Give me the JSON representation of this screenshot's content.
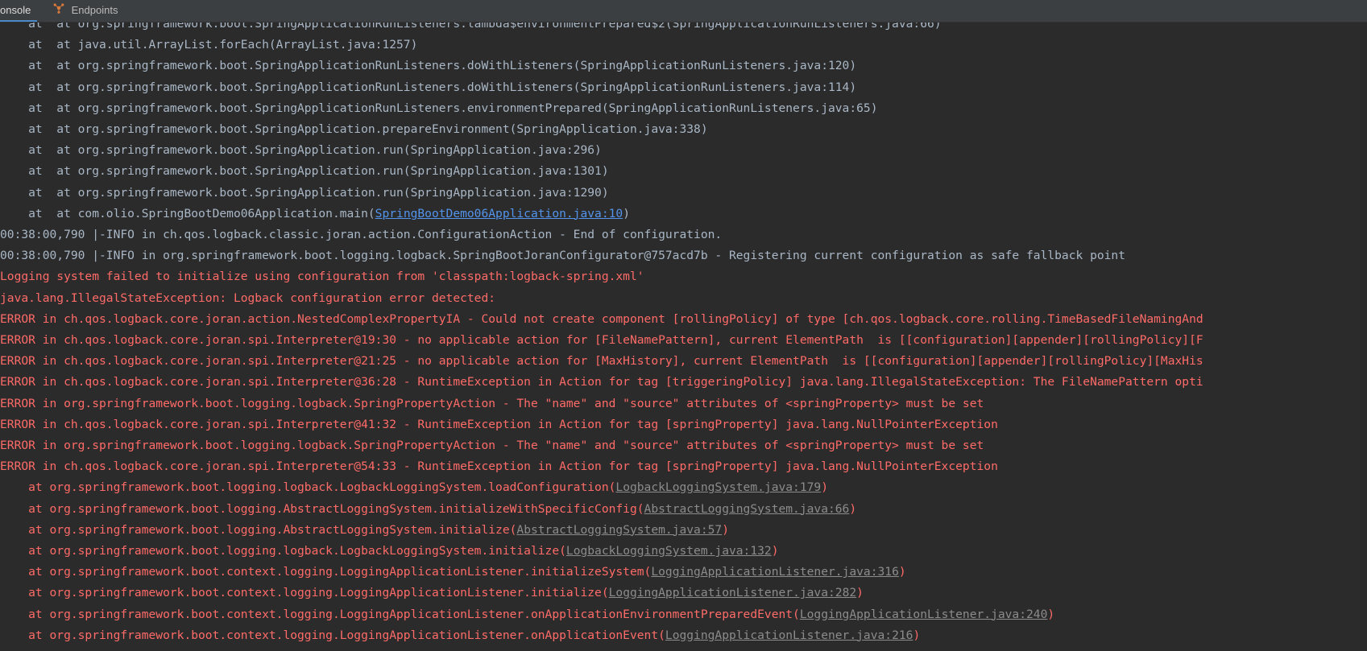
{
  "tabs": [
    {
      "label": "onsole"
    },
    {
      "label": "Endpoints"
    }
  ],
  "lines": [
    {
      "kind": "normal",
      "text": "    at  at org.springframework.boot.SpringApplicationRunListeners.lambda$environmentPrepared$2(SpringApplicationRunListeners.java:66)"
    },
    {
      "kind": "normal",
      "text": "    at  at java.util.ArrayList.forEach(ArrayList.java:1257)"
    },
    {
      "kind": "normal",
      "text": "    at  at org.springframework.boot.SpringApplicationRunListeners.doWithListeners(SpringApplicationRunListeners.java:120)"
    },
    {
      "kind": "normal",
      "text": "    at  at org.springframework.boot.SpringApplicationRunListeners.doWithListeners(SpringApplicationRunListeners.java:114)"
    },
    {
      "kind": "normal",
      "text": "    at  at org.springframework.boot.SpringApplicationRunListeners.environmentPrepared(SpringApplicationRunListeners.java:65)"
    },
    {
      "kind": "normal",
      "text": "    at  at org.springframework.boot.SpringApplication.prepareEnvironment(SpringApplication.java:338)"
    },
    {
      "kind": "normal",
      "text": "    at  at org.springframework.boot.SpringApplication.run(SpringApplication.java:296)"
    },
    {
      "kind": "normal",
      "text": "    at  at org.springframework.boot.SpringApplication.run(SpringApplication.java:1301)"
    },
    {
      "kind": "normal",
      "text": "    at  at org.springframework.boot.SpringApplication.run(SpringApplication.java:1290)"
    },
    {
      "kind": "normal",
      "text": "    at  at com.olio.SpringBootDemo06Application.main(",
      "link": "SpringBootDemo06Application.java:10",
      "link_style": "blue",
      "suffix": ")"
    },
    {
      "kind": "normal",
      "text": "00:38:00,790 |-INFO in ch.qos.logback.classic.joran.action.ConfigurationAction - End of configuration."
    },
    {
      "kind": "normal",
      "text": "00:38:00,790 |-INFO in org.springframework.boot.logging.logback.SpringBootJoranConfigurator@757acd7b - Registering current configuration as safe fallback point"
    },
    {
      "kind": "error",
      "text": "Logging system failed to initialize using configuration from 'classpath:logback-spring.xml'"
    },
    {
      "kind": "error",
      "text": "java.lang.IllegalStateException: Logback configuration error detected:"
    },
    {
      "kind": "error",
      "text": "ERROR in ch.qos.logback.core.joran.action.NestedComplexPropertyIA - Could not create component [rollingPolicy] of type [ch.qos.logback.core.rolling.TimeBasedFileNamingAnd"
    },
    {
      "kind": "error",
      "text": "ERROR in ch.qos.logback.core.joran.spi.Interpreter@19:30 - no applicable action for [FileNamePattern], current ElementPath  is [[configuration][appender][rollingPolicy][F"
    },
    {
      "kind": "error",
      "text": "ERROR in ch.qos.logback.core.joran.spi.Interpreter@21:25 - no applicable action for [MaxHistory], current ElementPath  is [[configuration][appender][rollingPolicy][MaxHis"
    },
    {
      "kind": "error",
      "text": "ERROR in ch.qos.logback.core.joran.spi.Interpreter@36:28 - RuntimeException in Action for tag [triggeringPolicy] java.lang.IllegalStateException: The FileNamePattern opti"
    },
    {
      "kind": "error",
      "text": "ERROR in org.springframework.boot.logging.logback.SpringPropertyAction - The \"name\" and \"source\" attributes of <springProperty> must be set"
    },
    {
      "kind": "error",
      "text": "ERROR in ch.qos.logback.core.joran.spi.Interpreter@41:32 - RuntimeException in Action for tag [springProperty] java.lang.NullPointerException"
    },
    {
      "kind": "error",
      "text": "ERROR in org.springframework.boot.logging.logback.SpringPropertyAction - The \"name\" and \"source\" attributes of <springProperty> must be set"
    },
    {
      "kind": "error",
      "text": "ERROR in ch.qos.logback.core.joran.spi.Interpreter@54:33 - RuntimeException in Action for tag [springProperty] java.lang.NullPointerException"
    },
    {
      "kind": "error",
      "text": "    at org.springframework.boot.logging.logback.LogbackLoggingSystem.loadConfiguration(",
      "link": "LogbackLoggingSystem.java:179",
      "link_style": "gray",
      "suffix": ")"
    },
    {
      "kind": "error",
      "text": "    at org.springframework.boot.logging.AbstractLoggingSystem.initializeWithSpecificConfig(",
      "link": "AbstractLoggingSystem.java:66",
      "link_style": "gray",
      "suffix": ")"
    },
    {
      "kind": "error",
      "text": "    at org.springframework.boot.logging.AbstractLoggingSystem.initialize(",
      "link": "AbstractLoggingSystem.java:57",
      "link_style": "gray",
      "suffix": ")"
    },
    {
      "kind": "error",
      "text": "    at org.springframework.boot.logging.logback.LogbackLoggingSystem.initialize(",
      "link": "LogbackLoggingSystem.java:132",
      "link_style": "gray",
      "suffix": ")"
    },
    {
      "kind": "error",
      "text": "    at org.springframework.boot.context.logging.LoggingApplicationListener.initializeSystem(",
      "link": "LoggingApplicationListener.java:316",
      "link_style": "gray",
      "suffix": ")"
    },
    {
      "kind": "error",
      "text": "    at org.springframework.boot.context.logging.LoggingApplicationListener.initialize(",
      "link": "LoggingApplicationListener.java:282",
      "link_style": "gray",
      "suffix": ")"
    },
    {
      "kind": "error",
      "text": "    at org.springframework.boot.context.logging.LoggingApplicationListener.onApplicationEnvironmentPreparedEvent(",
      "link": "LoggingApplicationListener.java:240",
      "link_style": "gray",
      "suffix": ")"
    },
    {
      "kind": "error",
      "text": "    at org.springframework.boot.context.logging.LoggingApplicationListener.onApplicationEvent(",
      "link": "LoggingApplicationListener.java:216",
      "link_style": "gray",
      "suffix": ")"
    }
  ],
  "colors": {
    "background": "#2b2b2b",
    "normal_text": "#a9b7c6",
    "error_text": "#ff6b68",
    "link_blue": "#5394ec",
    "link_gray": "#8c8c8c"
  },
  "icons": {
    "endpoints_tab": "endpoints-icon"
  }
}
